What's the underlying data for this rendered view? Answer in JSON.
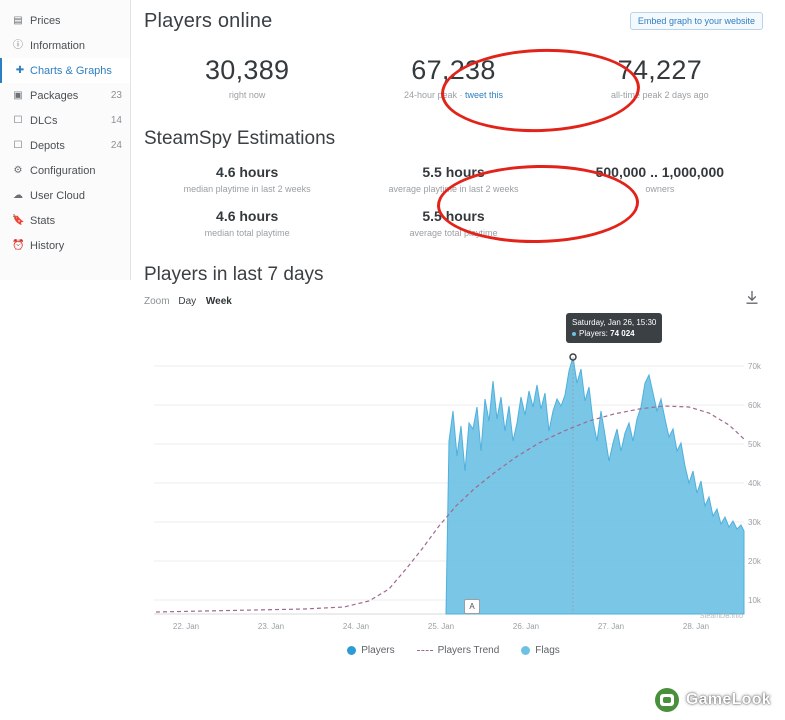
{
  "sidebar": {
    "items": [
      {
        "label": "Prices",
        "icon": "tag-icon",
        "count": "",
        "active": false
      },
      {
        "label": "Information",
        "icon": "info-icon",
        "count": "",
        "active": false
      },
      {
        "label": "Charts & Graphs",
        "icon": "chart-icon",
        "count": "",
        "active": true
      },
      {
        "label": "Packages",
        "icon": "package-icon",
        "count": "23",
        "active": false
      },
      {
        "label": "DLCs",
        "icon": "dlc-icon",
        "count": "14",
        "active": false
      },
      {
        "label": "Depots",
        "icon": "depot-icon",
        "count": "24",
        "active": false
      },
      {
        "label": "Configuration",
        "icon": "gear-icon",
        "count": "",
        "active": false
      },
      {
        "label": "User Cloud",
        "icon": "cloud-icon",
        "count": "",
        "active": false
      },
      {
        "label": "Stats",
        "icon": "bookmark-icon",
        "count": "",
        "active": false
      },
      {
        "label": "History",
        "icon": "clock-icon",
        "count": "",
        "active": false
      }
    ]
  },
  "players_online": {
    "title": "Players online",
    "embed_button": "Embed graph to your website",
    "stats": [
      {
        "value": "30,389",
        "label": "right now"
      },
      {
        "value": "67,238",
        "label": "24-hour peak",
        "link": "tweet this",
        "separator": "·"
      },
      {
        "value": "74,227",
        "label": "all-time peak 2 days ago"
      }
    ]
  },
  "steamspy": {
    "title": "SteamSpy Estimations",
    "row1": [
      {
        "value": "4.6 hours",
        "label": "median playtime in last 2 weeks"
      },
      {
        "value": "5.5 hours",
        "label": "average playtime in last 2 weeks"
      },
      {
        "value": "500,000 .. 1,000,000",
        "label": "owners"
      }
    ],
    "row2": [
      {
        "value": "4.6 hours",
        "label": "median total playtime"
      },
      {
        "value": "5.5 hours",
        "label": "average total playtime"
      }
    ]
  },
  "chart_panel": {
    "title": "Players in last 7 days",
    "zoom_label": "Zoom",
    "zoom_options": [
      {
        "label": "Day",
        "selected": false
      },
      {
        "label": "Week",
        "selected": true
      }
    ],
    "download_icon": "download-icon",
    "tooltip": {
      "date": "Saturday, Jan 26, 15:30",
      "series": "Players:",
      "value": "74 024"
    },
    "flag_label": "A",
    "legend": [
      {
        "label": "Players",
        "marker": "dot",
        "color": "#2e9bd6"
      },
      {
        "label": "Players Trend",
        "marker": "dash",
        "color": "#a06a8e"
      },
      {
        "label": "Flags",
        "marker": "dot",
        "color": "#6ec1e4"
      }
    ],
    "credit": "SteamDB.info"
  },
  "chart_data": {
    "type": "area",
    "title": "Players in last 7 days",
    "xlabel": "",
    "ylabel": "",
    "ylim": [
      0,
      75000
    ],
    "yticks": [
      "10k",
      "20k",
      "30k",
      "40k",
      "50k",
      "60k",
      "70k"
    ],
    "ytick_values": [
      10000,
      20000,
      30000,
      40000,
      50000,
      60000,
      70000
    ],
    "xticks": [
      "22. Jan",
      "23. Jan",
      "24. Jan",
      "25. Jan",
      "26. Jan",
      "27. Jan",
      "28. Jan"
    ],
    "grid": true,
    "legend_position": "bottom",
    "series": [
      {
        "name": "Players",
        "color": "#6ec1e4",
        "x": [
          0,
          4,
          8,
          12,
          16,
          20,
          24,
          28,
          32,
          36,
          40,
          44,
          48,
          50,
          52,
          54,
          56,
          58,
          60,
          62,
          64,
          66,
          68,
          70,
          72,
          74,
          76,
          78,
          80,
          82,
          84,
          86,
          88,
          90,
          92,
          94,
          96,
          98,
          100
        ],
        "values": [
          0,
          0,
          0,
          0,
          0,
          0,
          0,
          0,
          0,
          0,
          0,
          0,
          0,
          500,
          46000,
          38000,
          52000,
          44000,
          58000,
          50000,
          56000,
          54000,
          58000,
          48000,
          56000,
          60000,
          74024,
          62000,
          66000,
          58000,
          50000,
          54000,
          52000,
          66000,
          62000,
          56000,
          46000,
          38000,
          30000
        ]
      },
      {
        "name": "Players Trend",
        "color": "#a06a8e",
        "style": "dashed",
        "x": [
          0,
          10,
          20,
          30,
          36,
          42,
          48,
          54,
          60,
          66,
          72,
          78,
          84,
          90,
          96,
          100
        ],
        "values": [
          500,
          600,
          800,
          1200,
          4000,
          12000,
          24000,
          36000,
          46000,
          53000,
          57000,
          59000,
          60000,
          59000,
          54000,
          48000
        ]
      }
    ],
    "annotations": [
      {
        "label": "A",
        "x": 50,
        "type": "flag"
      },
      {
        "label": "Saturday, Jan 26, 15:30 — Players: 74 024",
        "x": 76,
        "y": 74024,
        "type": "tooltip"
      }
    ]
  },
  "watermark": {
    "text": "GameLook",
    "logo": "gamelook-logo"
  }
}
